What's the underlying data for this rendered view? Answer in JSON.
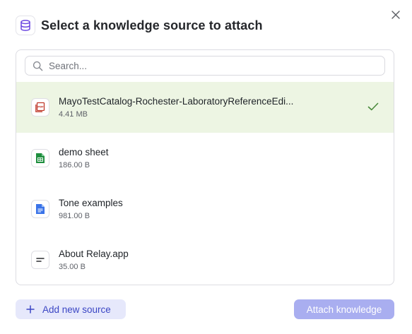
{
  "dialog": {
    "title": "Select a knowledge source to attach",
    "title_icon": "database-icon",
    "close_icon": "close-icon"
  },
  "search": {
    "placeholder": "Search...",
    "value": ""
  },
  "sources": [
    {
      "name": "MayoTestCatalog-Rochester-LaboratoryReferenceEdi...",
      "size": "4.41 MB",
      "icon": "pdf-file-icon",
      "selected": true
    },
    {
      "name": "demo sheet",
      "size": "186.00 B",
      "icon": "google-sheets-icon",
      "selected": false
    },
    {
      "name": "Tone examples",
      "size": "981.00 B",
      "icon": "google-docs-icon",
      "selected": false
    },
    {
      "name": "About Relay.app",
      "size": "35.00 B",
      "icon": "text-doc-icon",
      "selected": false
    }
  ],
  "footer": {
    "add_label": "Add new source",
    "attach_label": "Attach knowledge"
  },
  "colors": {
    "accent": "#3b46c4",
    "selected_bg": "#edf5e3",
    "check": "#4a8a3c",
    "attach_disabled": "#a9aef0"
  }
}
